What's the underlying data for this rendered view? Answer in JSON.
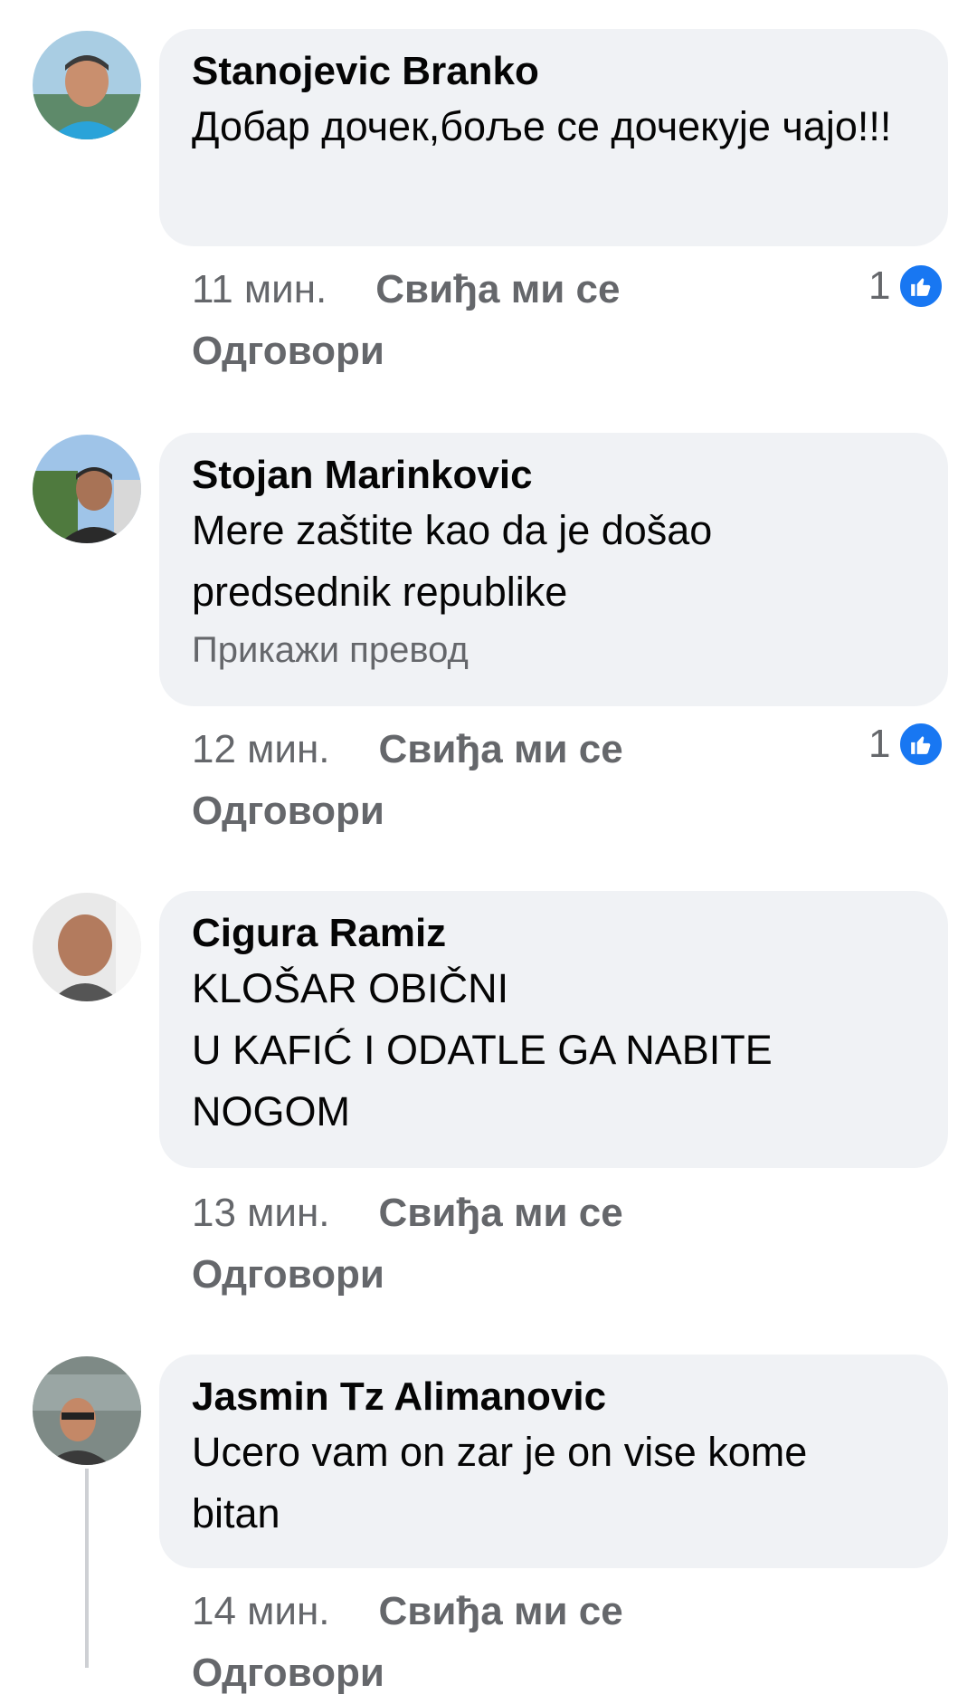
{
  "comments": [
    {
      "author": "Stanojevic Branko",
      "text": "Добар дочек,боље се дочекује чајо!!!",
      "translate": "",
      "time": "11 мин.",
      "like_label": "Свиђа ми се",
      "reply_label": "Одговори",
      "likes": "1"
    },
    {
      "author": "Stojan Marinkovic",
      "text": "Mere zaštite kao da je došao predsednik republike",
      "translate": "Прикажи превод",
      "time": "12 мин.",
      "like_label": "Свиђа ми се",
      "reply_label": "Одговори",
      "likes": "1"
    },
    {
      "author": "Cigura Ramiz",
      "text": "KLOŠAR OBIČNI\nU KAFIĆ I ODATLE GA NABITE NOGOM",
      "translate": "",
      "time": "13 мин.",
      "like_label": "Свиђа ми се",
      "reply_label": "Одговори",
      "likes": ""
    },
    {
      "author": "Jasmin Tz Alimanovic",
      "text": "Ucero vam on zar je on vise kome bitan",
      "translate": "",
      "time": "14 мин.",
      "like_label": "Свиђа ми се",
      "reply_label": "Одговори",
      "likes": ""
    }
  ],
  "colors": {
    "bubble": "#f0f2f5",
    "meta": "#65676b",
    "like_badge": "#1877f2"
  }
}
